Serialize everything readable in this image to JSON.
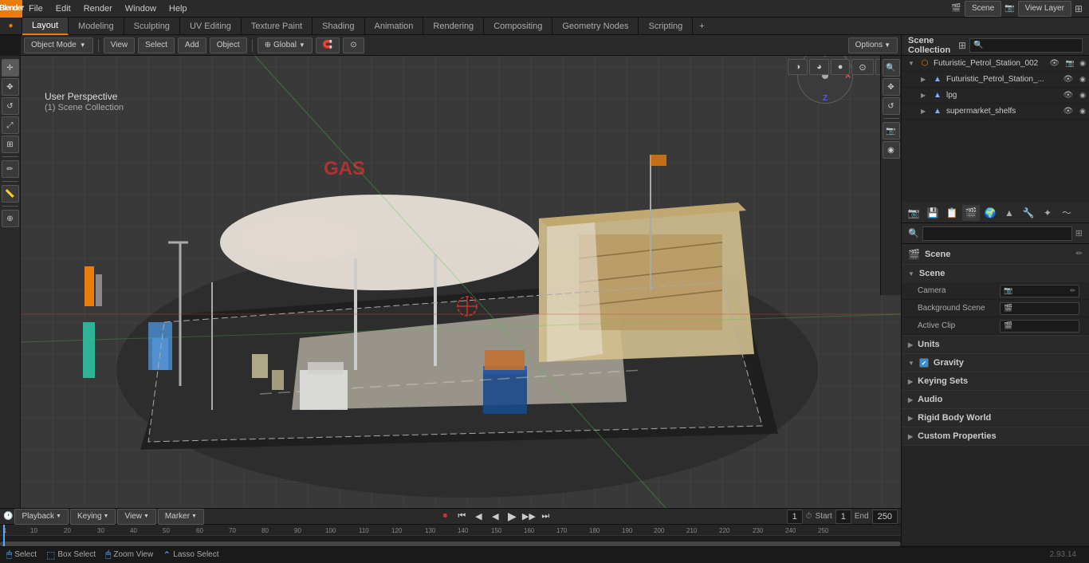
{
  "app": {
    "title": "Blender",
    "version": "2.93.14"
  },
  "top_menu": {
    "logo": "B",
    "items": [
      "File",
      "Edit",
      "Render",
      "Window",
      "Help"
    ]
  },
  "workspace_tabs": {
    "tabs": [
      "Layout",
      "Modeling",
      "Sculpting",
      "UV Editing",
      "Texture Paint",
      "Shading",
      "Animation",
      "Rendering",
      "Compositing",
      "Geometry Nodes",
      "Scripting"
    ],
    "active": "Layout",
    "add_label": "+"
  },
  "viewport_header": {
    "mode_label": "Object Mode",
    "view_label": "View",
    "select_label": "Select",
    "add_label": "Add",
    "object_label": "Object",
    "transform_label": "Global",
    "options_label": "Options"
  },
  "viewport": {
    "perspective_label": "User Perspective",
    "collection_label": "(1) Scene Collection"
  },
  "outliner": {
    "title": "Scene Collection",
    "items": [
      {
        "name": "Futuristic_Petrol_Station_002",
        "indent": 0,
        "expanded": true,
        "icon": "scene"
      },
      {
        "name": "Futuristic_Petrol_Station_...",
        "indent": 1,
        "expanded": false,
        "icon": "mesh"
      },
      {
        "name": "lpg",
        "indent": 1,
        "expanded": false,
        "icon": "mesh"
      },
      {
        "name": "supermarket_shelfs",
        "indent": 1,
        "expanded": false,
        "icon": "mesh"
      }
    ]
  },
  "properties": {
    "active_icon": "scene",
    "scene_label": "Scene",
    "section_scene": {
      "label": "Scene",
      "rows": [
        {
          "label": "Camera",
          "value": "●",
          "type": "picker"
        },
        {
          "label": "Background Scene",
          "value": "🎬",
          "type": "picker"
        },
        {
          "label": "Active Clip",
          "value": "🎬",
          "type": "picker"
        }
      ]
    },
    "section_units": {
      "label": "Units",
      "expanded": false
    },
    "section_gravity": {
      "label": "Gravity",
      "expanded": true,
      "checked": true
    },
    "section_keying": {
      "label": "Keying Sets",
      "expanded": false
    },
    "section_audio": {
      "label": "Audio",
      "expanded": false
    },
    "section_rigid": {
      "label": "Rigid Body World",
      "expanded": false
    },
    "section_custom": {
      "label": "Custom Properties",
      "expanded": false
    }
  },
  "timeline": {
    "playback_label": "Playback",
    "keying_label": "Keying",
    "view_label": "View",
    "marker_label": "Marker",
    "frame": "1",
    "start_label": "Start",
    "start_value": "1",
    "end_label": "End",
    "end_value": "250",
    "transport": [
      "⏮",
      "⏭",
      "◀",
      "▶",
      "▶▶"
    ],
    "tick_labels": [
      "1",
      "10",
      "20",
      "30",
      "40",
      "50",
      "60",
      "70",
      "80",
      "90",
      "100",
      "110",
      "120",
      "130",
      "140",
      "150",
      "160",
      "170",
      "180",
      "190",
      "200",
      "210",
      "220",
      "230",
      "240",
      "250"
    ]
  },
  "status_bar": {
    "select_label": "Select",
    "box_select_label": "Box Select",
    "zoom_label": "Zoom View",
    "lasso_label": "Lasso Select"
  },
  "icons": {
    "expand": "▶",
    "collapse": "▼",
    "eye": "👁",
    "camera": "📷",
    "mesh": "▲",
    "scene": "🎬",
    "cursor": "✛",
    "move": "✥",
    "rotate": "↺",
    "scale": "⤢",
    "transform": "⊞",
    "annotate": "✏",
    "measure": "📏",
    "add_mesh": "⊕"
  },
  "colors": {
    "accent": "#e87d0d",
    "active_tab_bg": "#3a3a3a",
    "panel_bg": "#252525",
    "header_bg": "#2a2a2a",
    "viewport_bg": "#393939",
    "selected_blue": "#264f78",
    "axis_x": "#f55555",
    "axis_y": "#55aa55",
    "axis_z": "#5555ff"
  }
}
